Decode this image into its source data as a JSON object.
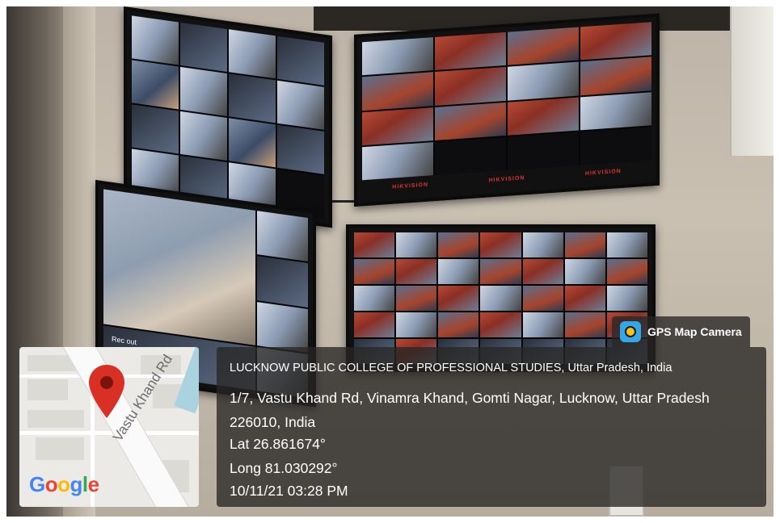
{
  "app_tag": {
    "label": "GPS Map Camera",
    "icon": "camera-lens-icon"
  },
  "location": {
    "place_name": "LUCKNOW PUBLIC COLLEGE OF PROFESSIONAL STUDIES, Uttar Pradesh, India",
    "address": "1/7, Vastu Khand Rd, Vinamra Khand, Gomti Nagar, Lucknow, Uttar Pradesh 226010, India",
    "latitude": "Lat 26.861674°",
    "longitude": "Long 81.030292°",
    "datetime": "10/11/21 03:28 PM"
  },
  "map": {
    "road_label": "Vastu Khand Rd",
    "logo": "Google",
    "pin_icon": "map-pin-icon",
    "pin_color": "#d93025"
  },
  "scene": {
    "monitor_brand": "HIKVISION",
    "monitor_overlay": "Rec out"
  },
  "colors": {
    "overlay_bg": "#282624",
    "google_blue": "#4285f4",
    "google_red": "#ea4335",
    "google_yellow": "#fbbc05",
    "google_green": "#34a853"
  }
}
